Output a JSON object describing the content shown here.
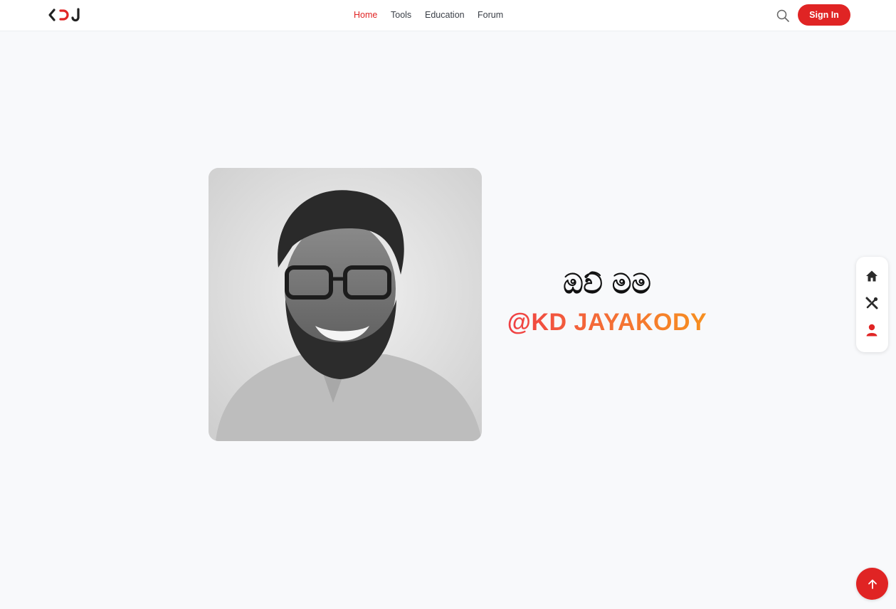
{
  "header": {
    "logo_text": "KDJ",
    "nav": [
      {
        "label": "Home",
        "active": true
      },
      {
        "label": "Tools",
        "active": false
      },
      {
        "label": "Education",
        "active": false
      },
      {
        "label": "Forum",
        "active": false
      }
    ],
    "search_icon": "search-icon",
    "signin_label": "Sign In"
  },
  "hero": {
    "greeting": "ඔව් මම",
    "handle": "@KD JAYAKODY",
    "photo_icon": "profile-photo"
  },
  "side_dock": {
    "items": [
      {
        "icon": "home-icon"
      },
      {
        "icon": "tools-icon"
      },
      {
        "icon": "user-icon"
      }
    ]
  },
  "scroll_top_icon": "arrow-up-icon",
  "colors": {
    "accent": "#e02424",
    "background": "#f8f9fb",
    "gradient_start": "#ef3a45",
    "gradient_end": "#f7931e"
  }
}
